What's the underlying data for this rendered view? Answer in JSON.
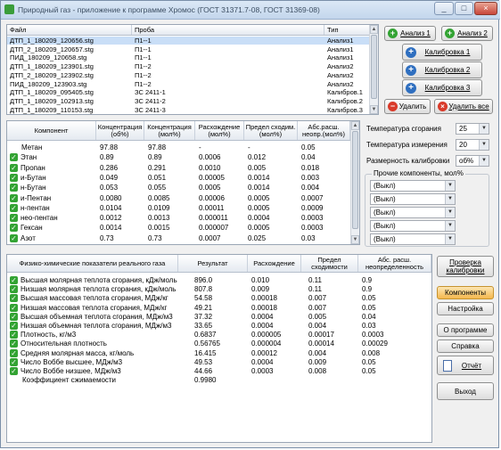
{
  "window": {
    "title": "Природный газ - приложение к программе Хромос (ГОСТ 31371.7-08, ГОСТ 31369-08)",
    "minimize_label": "_",
    "maximize_label": "□",
    "close_label": "×"
  },
  "files": {
    "headers": [
      "Файл",
      "Проба",
      "Тип"
    ],
    "rows": [
      [
        "ДТП_1_180209_120656.stg",
        "П1--1",
        "Анализ1"
      ],
      [
        "ДТП_2_180209_120657.stg",
        "П1--1",
        "Анализ1"
      ],
      [
        "ПИД_180209_120658.stg",
        "П1--1",
        "Анализ1"
      ],
      [
        "ДТП_1_180209_123901.stg",
        "П1--2",
        "Анализ2"
      ],
      [
        "ДТП_2_180209_123902.stg",
        "П1--2",
        "Анализ2"
      ],
      [
        "ПИД_180209_123903.stg",
        "П1--2",
        "Анализ2"
      ],
      [
        "ДТП_1_180209_095405.stg",
        "ЗС 2411-1",
        "Калибров.1"
      ],
      [
        "ДТП_1_180209_102913.stg",
        "ЗС 2411-2",
        "Калибров.2"
      ],
      [
        "ДТП_1_180209_110153.stg",
        "ЗС 2411-3",
        "Калибров.3"
      ]
    ]
  },
  "actions": {
    "analysis1": "Анализ 1",
    "analysis2": "Анализ 2",
    "calib1": "Калибровка 1",
    "calib2": "Калибровка 2",
    "calib3": "Калибровка 3",
    "delete": "Удалить",
    "delete_all": "Удалить все"
  },
  "components": {
    "headers": [
      "Компонент",
      "Концентрация (об%)",
      "Концентрация (мол%)",
      "Расхождение (мол%)",
      "Предел сходим. (мол%)",
      "Абс.расш. неопр.(мол%)"
    ],
    "rows": [
      {
        "check": false,
        "name": "Метан",
        "v": [
          "97.88",
          "97.88",
          "-",
          "-",
          "0.05"
        ]
      },
      {
        "check": true,
        "name": "Этан",
        "v": [
          "0.89",
          "0.89",
          "0.0006",
          "0.012",
          "0.04"
        ]
      },
      {
        "check": true,
        "name": "Пропан",
        "v": [
          "0.286",
          "0.291",
          "0.0010",
          "0.005",
          "0.018"
        ]
      },
      {
        "check": true,
        "name": "и-Бутан",
        "v": [
          "0.049",
          "0.051",
          "0.00005",
          "0.0014",
          "0.003"
        ]
      },
      {
        "check": true,
        "name": "н-Бутан",
        "v": [
          "0.053",
          "0.055",
          "0.0005",
          "0.0014",
          "0.004"
        ]
      },
      {
        "check": true,
        "name": "и-Пентан",
        "v": [
          "0.0080",
          "0.0085",
          "0.00006",
          "0.0005",
          "0.0007"
        ]
      },
      {
        "check": true,
        "name": "н-пентан",
        "v": [
          "0.0104",
          "0.0109",
          "0.00011",
          "0.0005",
          "0.0009"
        ]
      },
      {
        "check": true,
        "name": "нео-пентан",
        "v": [
          "0.0012",
          "0.0013",
          "0.000011",
          "0.0004",
          "0.0003"
        ]
      },
      {
        "check": true,
        "name": "Гексан",
        "v": [
          "0.0014",
          "0.0015",
          "0.000007",
          "0.0005",
          "0.0003"
        ]
      },
      {
        "check": true,
        "name": "Азот",
        "v": [
          "0.73",
          "0.73",
          "0.0007",
          "0.025",
          "0.03"
        ]
      }
    ]
  },
  "settings": {
    "combustion_temp_label": "Температура сгорания",
    "combustion_temp_value": "25",
    "measure_temp_label": "Температура измерения",
    "measure_temp_value": "20",
    "calib_dim_label": "Размерность калибровки",
    "calib_dim_value": "об%",
    "other_group_label": "Прочие компоненты, мол%",
    "other_values": [
      "(Выкл)",
      "(Выкл)",
      "(Выкл)",
      "(Выкл)",
      "(Выкл)"
    ]
  },
  "physics": {
    "headers": [
      "Физико-химические показатели реального газа",
      "Результат",
      "Расхождение",
      "Предел сходимости",
      "Абс. расш. неопределенность"
    ],
    "rows": [
      {
        "check": true,
        "name": "Высшая молярная теплота сгорания, кДж/моль",
        "v": [
          "896.0",
          "0.010",
          "0.11",
          "0.9"
        ]
      },
      {
        "check": true,
        "name": "Низшая молярная теплота сгорания, кДж/моль",
        "v": [
          "807.8",
          "0.009",
          "0.11",
          "0.9"
        ]
      },
      {
        "check": true,
        "name": "Высшая массовая теплота сгорания, МДж/кг",
        "v": [
          "54.58",
          "0.00018",
          "0.007",
          "0.05"
        ]
      },
      {
        "check": true,
        "name": "Низшая массовая теплота сгорания, МДж/кг",
        "v": [
          "49.21",
          "0.00018",
          "0.007",
          "0.05"
        ]
      },
      {
        "check": true,
        "name": "Высшая объемная теплота сгорания, МДж/м3",
        "v": [
          "37.32",
          "0.0004",
          "0.005",
          "0.04"
        ]
      },
      {
        "check": true,
        "name": "Низшая объемная теплота сгорания, МДж/м3",
        "v": [
          "33.65",
          "0.0004",
          "0.004",
          "0.03"
        ]
      },
      {
        "check": true,
        "name": "Плотность, кг/м3",
        "v": [
          "0.6837",
          "0.000005",
          "0.00017",
          "0.0003"
        ]
      },
      {
        "check": true,
        "name": "Относительная плотность",
        "v": [
          "0.56765",
          "0.000004",
          "0.00014",
          "0.00029"
        ]
      },
      {
        "check": true,
        "name": "Средняя молярная масса, кг/моль",
        "v": [
          "16.415",
          "0.00012",
          "0.004",
          "0.008"
        ]
      },
      {
        "check": true,
        "name": "Число Воббе высшее, МДж/м3",
        "v": [
          "49.53",
          "0.0004",
          "0.009",
          "0.05"
        ]
      },
      {
        "check": true,
        "name": "Число Воббе низшее, МДж/м3",
        "v": [
          "44.66",
          "0.0003",
          "0.008",
          "0.05"
        ]
      },
      {
        "check": false,
        "name": "Коэффициент сжимаемости",
        "v": [
          "0.9980",
          "",
          "",
          ""
        ]
      }
    ]
  },
  "side_buttons": {
    "check_calib": "Проверка калибровки",
    "components": "Компоненты",
    "settings": "Настройка",
    "about": "О программе",
    "help": "Справка",
    "report": "Отчёт",
    "exit": "Выход"
  },
  "colors": {
    "accent_green": "#33a333",
    "accent_blue": "#2f6fc0",
    "accent_red": "#d93a2a",
    "selection": "#c9def7",
    "highlight_button": "#f8c864"
  }
}
